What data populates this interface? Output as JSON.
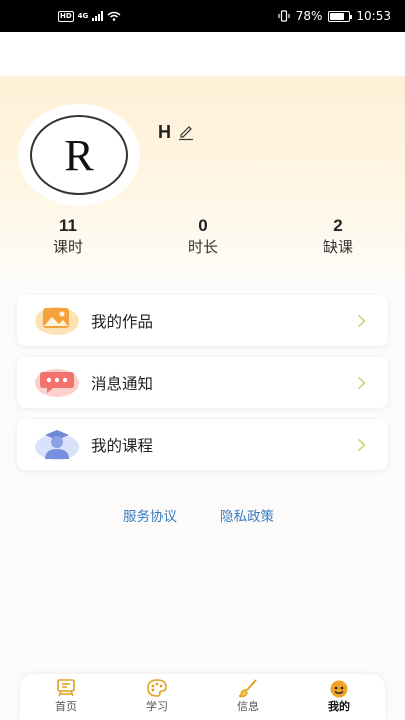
{
  "status_bar": {
    "hd": "HD",
    "network": "4G",
    "battery_text": "78%",
    "battery_level": 0.78,
    "time": "10:53"
  },
  "profile": {
    "avatar_letter": "R",
    "username": "H"
  },
  "stats": [
    {
      "value": "11",
      "label": "课时"
    },
    {
      "value": "0",
      "label": "时长"
    },
    {
      "value": "2",
      "label": "缺课"
    }
  ],
  "menu": [
    {
      "label": "我的作品",
      "icon": "image-icon"
    },
    {
      "label": "消息通知",
      "icon": "message-icon"
    },
    {
      "label": "我的课程",
      "icon": "student-icon"
    }
  ],
  "links": {
    "service_agreement": "服务协议",
    "privacy_policy": "隐私政策"
  },
  "nav": [
    {
      "label": "首页",
      "icon": "home-icon"
    },
    {
      "label": "学习",
      "icon": "palette-icon"
    },
    {
      "label": "信息",
      "icon": "brush-icon"
    },
    {
      "label": "我的",
      "icon": "smiley-icon",
      "active": true
    }
  ],
  "colors": {
    "accent_link": "#3a7bc2",
    "nav_icon": "#e0a21d",
    "chevron": "#c8d67a",
    "header_gradient_top": "#fdf0d6"
  }
}
